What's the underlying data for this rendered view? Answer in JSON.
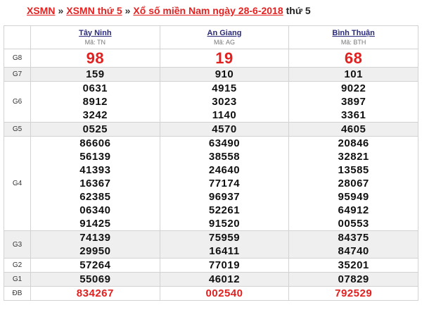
{
  "breadcrumb": {
    "link1": "XSMN",
    "sep1": "»",
    "link2": "XSMN thứ 5",
    "sep2": "»",
    "link3": "Xổ số miền Nam ngày 28-6-2018",
    "tail": "thứ 5"
  },
  "provinces": [
    {
      "name": "Tây Ninh",
      "code": "Mã: TN"
    },
    {
      "name": "An Giang",
      "code": "Mã: AG"
    },
    {
      "name": "Bình Thuận",
      "code": "Mã: BTH"
    }
  ],
  "prizes": {
    "g8": {
      "label": "G8",
      "values": [
        [
          "98"
        ],
        [
          "19"
        ],
        [
          "68"
        ]
      ]
    },
    "g7": {
      "label": "G7",
      "values": [
        [
          "159"
        ],
        [
          "910"
        ],
        [
          "101"
        ]
      ]
    },
    "g6": {
      "label": "G6",
      "values": [
        [
          "0631",
          "8912",
          "3242"
        ],
        [
          "4915",
          "3023",
          "1140"
        ],
        [
          "9022",
          "3897",
          "3361"
        ]
      ]
    },
    "g5": {
      "label": "G5",
      "values": [
        [
          "0525"
        ],
        [
          "4570"
        ],
        [
          "4605"
        ]
      ]
    },
    "g4": {
      "label": "G4",
      "values": [
        [
          "86606",
          "56139",
          "41393",
          "16367",
          "62385",
          "06340",
          "91425"
        ],
        [
          "63490",
          "38558",
          "24640",
          "77174",
          "96937",
          "52261",
          "91520"
        ],
        [
          "20846",
          "32821",
          "13585",
          "28067",
          "95949",
          "64912",
          "00553"
        ]
      ]
    },
    "g3": {
      "label": "G3",
      "values": [
        [
          "74139",
          "29950"
        ],
        [
          "75959",
          "16411"
        ],
        [
          "84375",
          "84740"
        ]
      ]
    },
    "g2": {
      "label": "G2",
      "values": [
        [
          "57264"
        ],
        [
          "77019"
        ],
        [
          "35201"
        ]
      ]
    },
    "g1": {
      "label": "G1",
      "values": [
        [
          "55069"
        ],
        [
          "46012"
        ],
        [
          "07829"
        ]
      ]
    },
    "db": {
      "label": "ĐB",
      "values": [
        [
          "834267"
        ],
        [
          "002540"
        ],
        [
          "792529"
        ]
      ]
    }
  },
  "colors": {
    "accent": "#e12020",
    "provinceLink": "#2a2a7a",
    "shade": "#efefef"
  }
}
